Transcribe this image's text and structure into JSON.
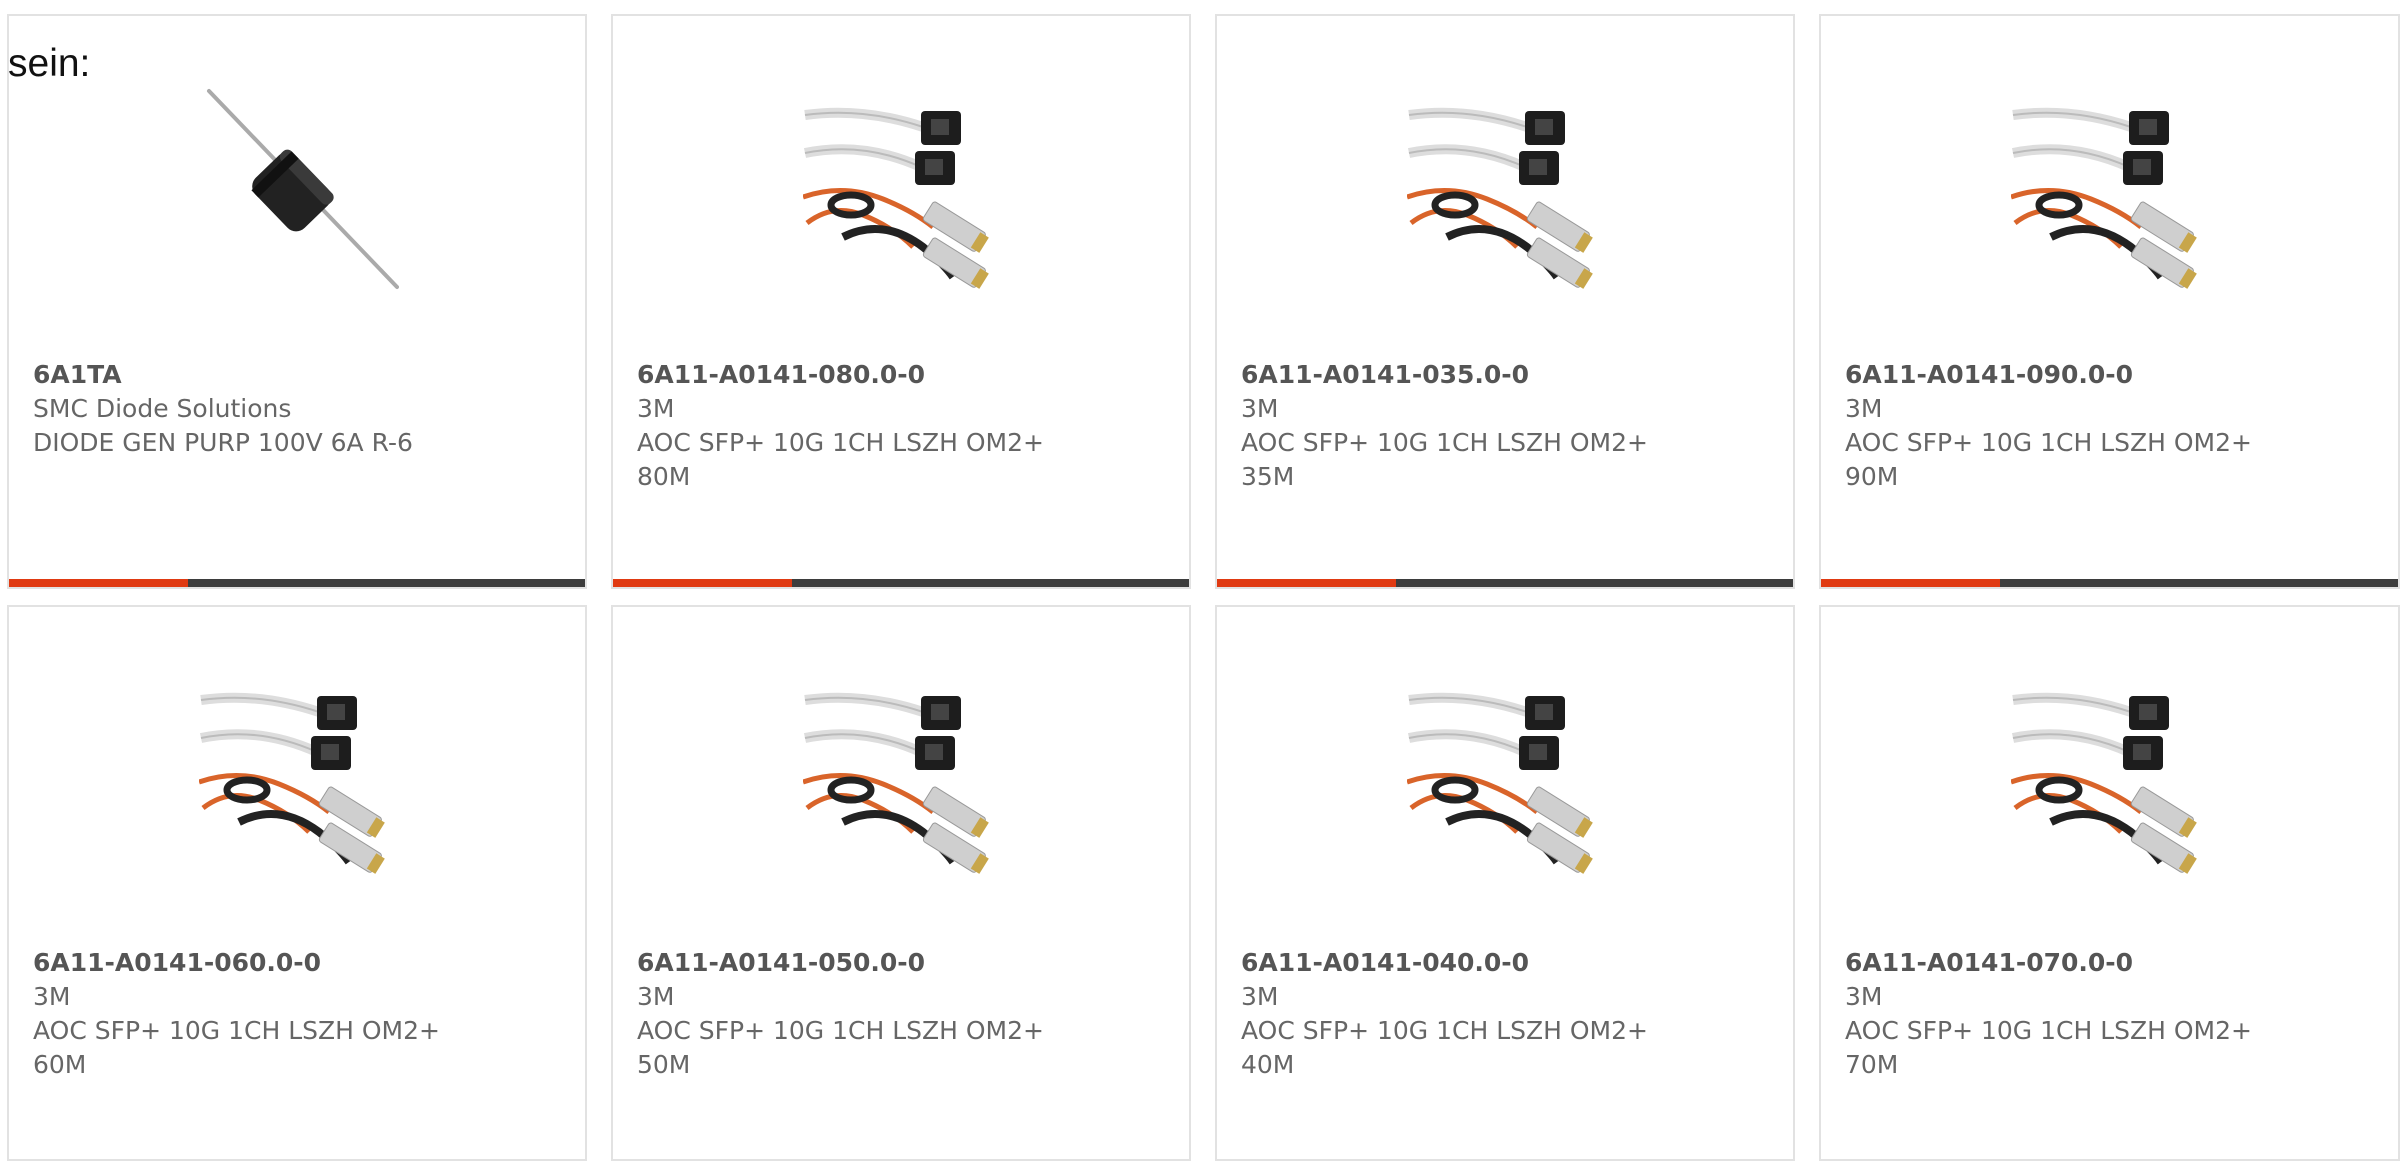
{
  "sein_label": "sein:",
  "accent_color": "#e03a12",
  "bar_color": "#3d3d3d",
  "cards": [
    {
      "part": "6A1TA",
      "maker": "SMC Diode Solutions",
      "desc": "DIODE GEN PURP 100V 6A R-6",
      "image": "diode-image",
      "progress": 0.31
    },
    {
      "part": "6A11-A0141-080.0-0",
      "maker": "3M",
      "desc": "AOC SFP+ 10G 1CH LSZH OM2+\n80M",
      "image": "cable-image",
      "progress": 0.31
    },
    {
      "part": "6A11-A0141-035.0-0",
      "maker": "3M",
      "desc": "AOC SFP+ 10G 1CH LSZH OM2+\n35M",
      "image": "cable-image",
      "progress": 0.31
    },
    {
      "part": "6A11-A0141-090.0-0",
      "maker": "3M",
      "desc": "AOC SFP+ 10G 1CH LSZH OM2+\n90M",
      "image": "cable-image",
      "progress": 0.31
    },
    {
      "part": "6A11-A0141-060.0-0",
      "maker": "3M",
      "desc": "AOC SFP+ 10G 1CH LSZH OM2+\n60M",
      "image": "cable-image"
    },
    {
      "part": "6A11-A0141-050.0-0",
      "maker": "3M",
      "desc": "AOC SFP+ 10G 1CH LSZH OM2+\n50M",
      "image": "cable-image"
    },
    {
      "part": "6A11-A0141-040.0-0",
      "maker": "3M",
      "desc": "AOC SFP+ 10G 1CH LSZH OM2+\n40M",
      "image": "cable-image"
    },
    {
      "part": "6A11-A0141-070.0-0",
      "maker": "3M",
      "desc": "AOC SFP+ 10G 1CH LSZH OM2+\n70M",
      "image": "cable-image"
    }
  ]
}
